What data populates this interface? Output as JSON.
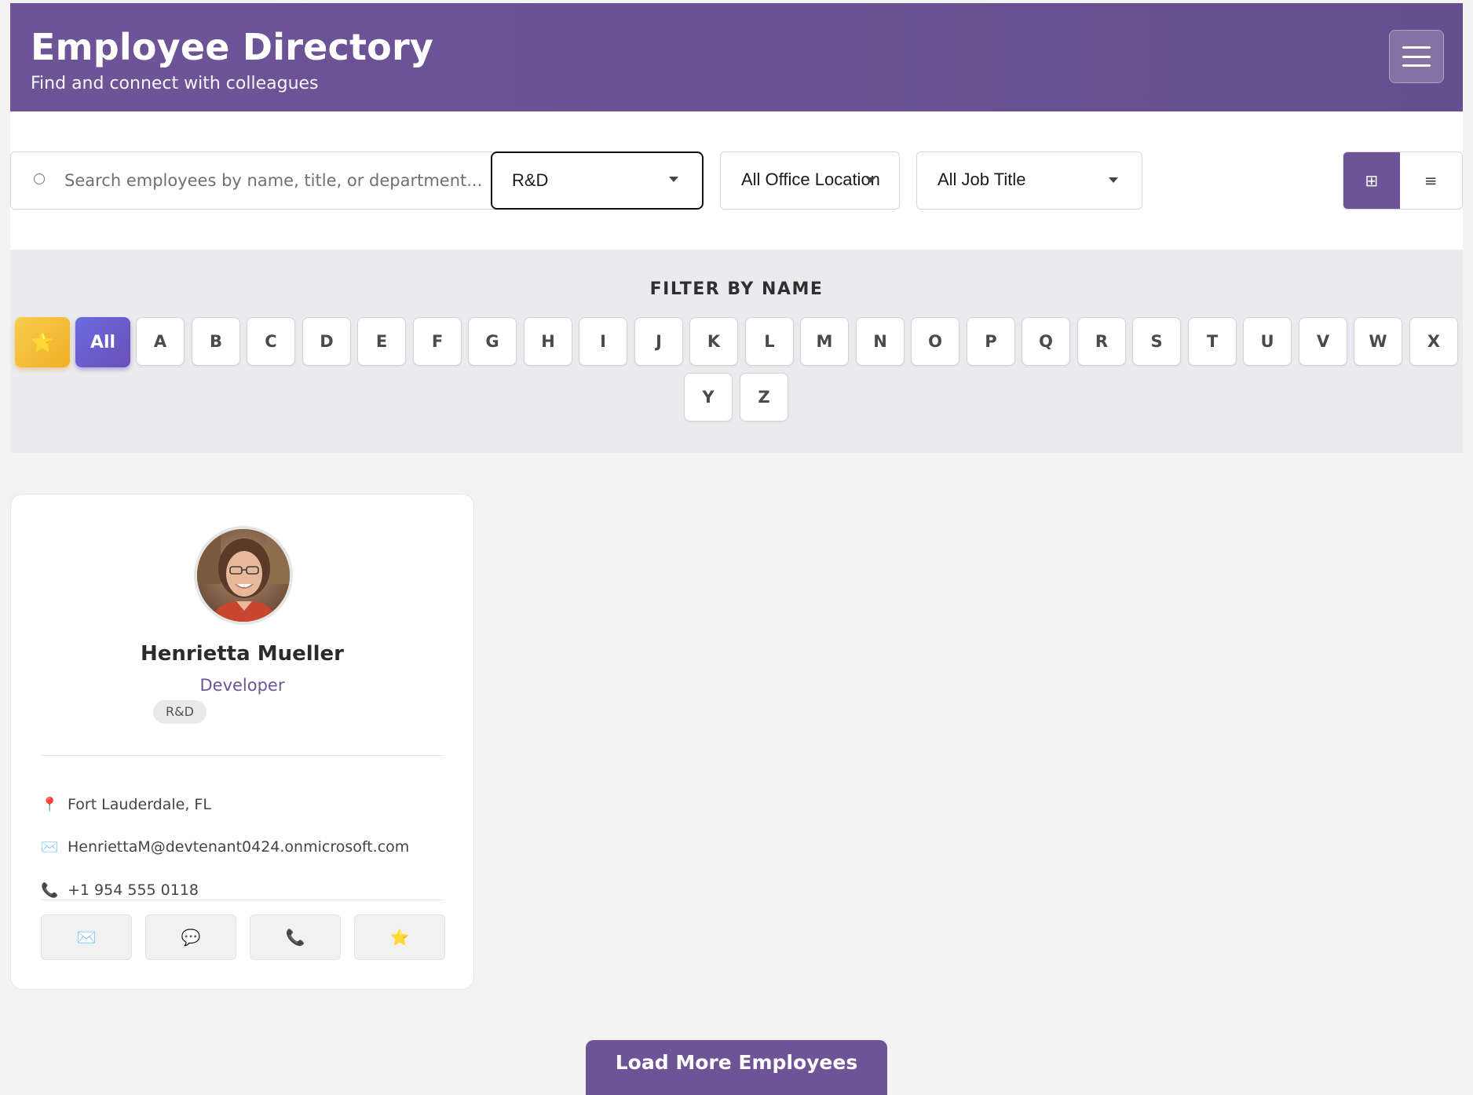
{
  "header": {
    "title": "Employee Directory",
    "subtitle": "Find and connect with colleagues",
    "menu_icon": "hamburger-menu-icon"
  },
  "toolbar": {
    "search_placeholder": "Search employees by name, title, or department...",
    "search_value": "",
    "department_filter": "R&D",
    "location_filter": "All Office Location",
    "job_title_filter": "All Job Title",
    "view_modes": [
      {
        "icon": "grid-view-icon",
        "glyph": "⊞",
        "active": true
      },
      {
        "icon": "list-view-icon",
        "glyph": "≡",
        "active": false
      }
    ]
  },
  "alphabet": {
    "title": "FILTER BY NAME",
    "favorites_glyph": "⭐",
    "all_label": "All",
    "letters": [
      "A",
      "B",
      "C",
      "D",
      "E",
      "F",
      "G",
      "H",
      "I",
      "J",
      "K",
      "L",
      "M",
      "N",
      "O",
      "P",
      "Q",
      "R",
      "S",
      "T",
      "U",
      "V",
      "W",
      "X",
      "Y",
      "Z"
    ],
    "selected": "All"
  },
  "employees": [
    {
      "name": "Henrietta Mueller",
      "job_title": "Developer",
      "department": "R&D",
      "location": "Fort Lauderdale, FL",
      "email": "HenriettaM@devtenant0424.onmicrosoft.com",
      "phone": "+1 954 555 0118",
      "icons": {
        "location": "📍",
        "email": "✉️",
        "phone": "📞"
      },
      "actions": [
        {
          "name": "email",
          "glyph": "✉️"
        },
        {
          "name": "chat",
          "glyph": "💬"
        },
        {
          "name": "call",
          "glyph": "📞"
        },
        {
          "name": "favorite",
          "glyph": "⭐"
        }
      ]
    }
  ],
  "load_more_label": "Load More Employees",
  "colors": {
    "brand": "#6c5496",
    "favorite": "#f3bb34",
    "all_button": "#6a5bcf"
  }
}
